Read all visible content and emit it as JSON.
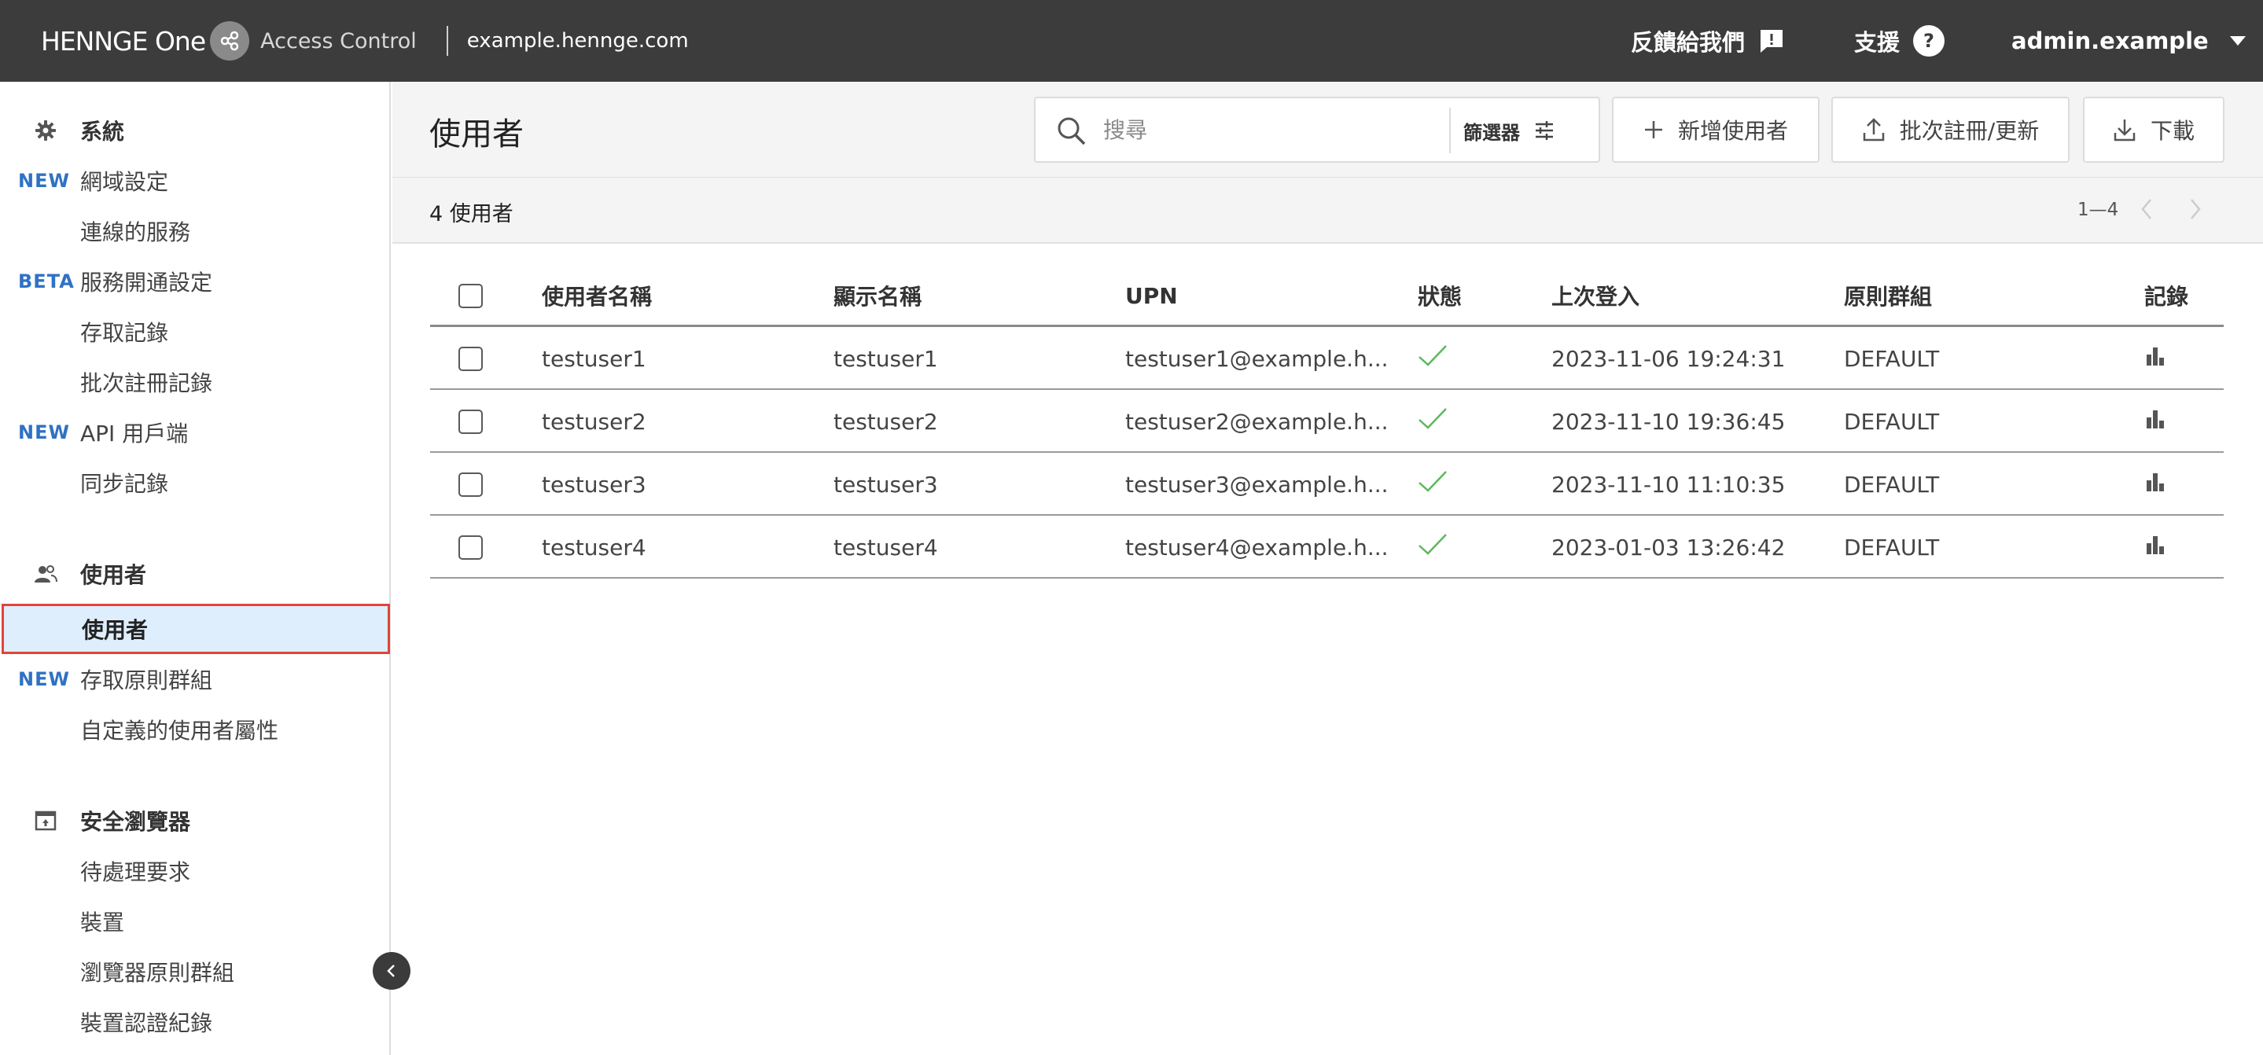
{
  "header": {
    "brand": "HENNGE One",
    "product": "Access Control",
    "domain": "example.hennge.com",
    "feedback_label": "反饋給我們",
    "support_label": "支援",
    "account_label": "admin.example"
  },
  "sidebar": {
    "sections": [
      {
        "title": "系統",
        "icon": "gear-icon",
        "items": [
          {
            "badge": "NEW",
            "label": "網域設定"
          },
          {
            "badge": "",
            "label": "連線的服務"
          },
          {
            "badge": "BETA",
            "label": "服務開通設定"
          },
          {
            "badge": "",
            "label": "存取記錄"
          },
          {
            "badge": "",
            "label": "批次註冊記錄"
          },
          {
            "badge": "NEW",
            "label": "API 用戶端"
          },
          {
            "badge": "",
            "label": "同步記錄"
          }
        ]
      },
      {
        "title": "使用者",
        "icon": "users-icon",
        "items": [
          {
            "badge": "",
            "label": "使用者",
            "active": true
          },
          {
            "badge": "NEW",
            "label": "存取原則群組"
          },
          {
            "badge": "",
            "label": "自定義的使用者屬性"
          }
        ]
      },
      {
        "title": "安全瀏覽器",
        "icon": "browser-icon",
        "items": [
          {
            "badge": "",
            "label": "待處理要求"
          },
          {
            "badge": "",
            "label": "裝置"
          },
          {
            "badge": "",
            "label": "瀏覽器原則群組"
          },
          {
            "badge": "",
            "label": "裝置認證紀錄"
          }
        ]
      }
    ]
  },
  "main": {
    "title": "使用者",
    "search": {
      "placeholder": "搜尋",
      "value": ""
    },
    "filter_label": "篩選器",
    "buttons": {
      "add_user": "新增使用者",
      "batch": "批次註冊/更新",
      "download": "下載"
    },
    "count_label": "4 使用者",
    "pager_range": "1—4"
  },
  "table": {
    "columns": [
      "使用者名稱",
      "顯示名稱",
      "UPN",
      "狀態",
      "上次登入",
      "原則群組",
      "記錄"
    ],
    "rows": [
      {
        "username": "testuser1",
        "display": "testuser1",
        "upn": "testuser1@example.h...",
        "status": "active",
        "last_login": "2023-11-06 19:24:31",
        "group": "DEFAULT"
      },
      {
        "username": "testuser2",
        "display": "testuser2",
        "upn": "testuser2@example.h...",
        "status": "active",
        "last_login": "2023-11-10 19:36:45",
        "group": "DEFAULT"
      },
      {
        "username": "testuser3",
        "display": "testuser3",
        "upn": "testuser3@example.h...",
        "status": "active",
        "last_login": "2023-11-10 11:10:35",
        "group": "DEFAULT"
      },
      {
        "username": "testuser4",
        "display": "testuser4",
        "upn": "testuser4@example.h...",
        "status": "active",
        "last_login": "2023-01-03 13:26:42",
        "group": "DEFAULT"
      }
    ]
  },
  "colors": {
    "header_bg": "#3c3c3c",
    "badge_blue": "#2f72c4",
    "active_bg": "#dfeefd",
    "highlight_border": "#e0443a",
    "status_green": "#5cb85c"
  }
}
